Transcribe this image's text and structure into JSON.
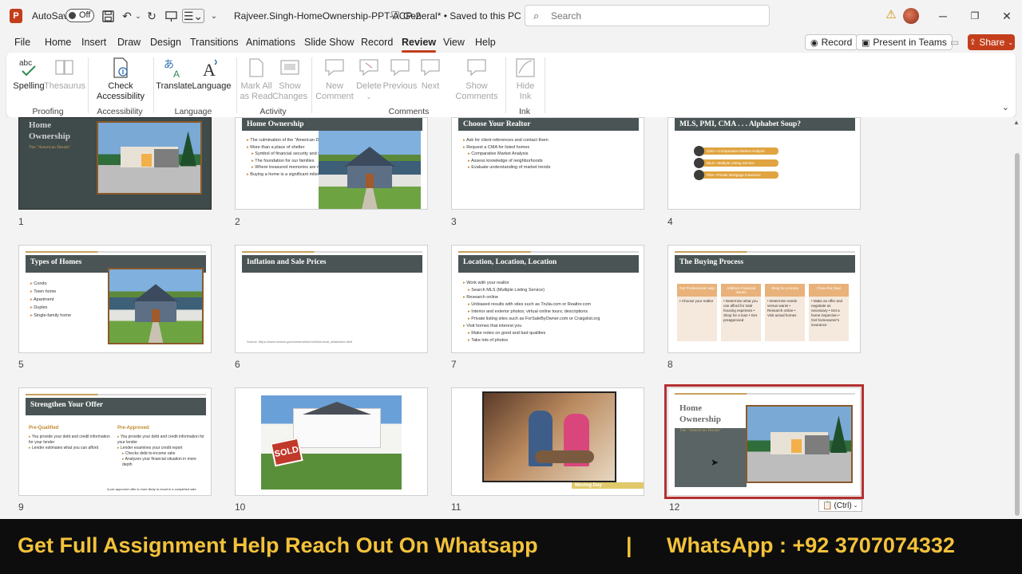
{
  "titlebar": {
    "app_logo": "P",
    "autosave_label": "AutoSave",
    "autosave_state": "Off",
    "document_title": "Rajveer.Singh-HomeOwnership-PPT-ACP-2",
    "sensitivity": "General* • Saved to this PC",
    "search_placeholder": "Search"
  },
  "menu": {
    "tabs": [
      "File",
      "Home",
      "Insert",
      "Draw",
      "Design",
      "Transitions",
      "Animations",
      "Slide Show",
      "Record",
      "Review",
      "View",
      "Help"
    ],
    "active_tab": "Review",
    "record_button": "Record",
    "present_teams_button": "Present in Teams",
    "share_button": "Share"
  },
  "ribbon": {
    "spelling": "Spelling",
    "thesaurus": "Thesaurus",
    "check_accessibility_1": "Check",
    "check_accessibility_2": "Accessibility",
    "translate": "Translate",
    "language": "Language",
    "mark_all_1": "Mark All",
    "mark_all_2": "as Read",
    "show_changes_1": "Show",
    "show_changes_2": "Changes",
    "new_comment_1": "New",
    "new_comment_2": "Comment",
    "delete": "Delete",
    "previous": "Previous",
    "next": "Next",
    "show_comments_1": "Show",
    "show_comments_2": "Comments",
    "hide_ink_1": "Hide",
    "hide_ink_2": "Ink",
    "groups": [
      "Proofing",
      "Accessibility",
      "Language",
      "Activity",
      "Comments",
      "Ink"
    ]
  },
  "slides": {
    "s1": {
      "num": "1",
      "title1": "Home",
      "title2": "Ownership",
      "sub": "The \"American Dream\""
    },
    "s2": {
      "num": "2",
      "title": "Home Ownership",
      "bullets": [
        "The culmination of the \"American Dream\"",
        "More than a place of shelter",
        "Symbol of financial security and stability",
        "The foundation for our families",
        "Where treasured memories are made",
        "Buying a home is a significant milestone"
      ]
    },
    "s3": {
      "num": "3",
      "title": "Choose Your Realtor",
      "bullets": [
        "Ask for client references and contact them",
        "Request a CMA for listed homes",
        "Comparative Market Analysis",
        "Assess knowledge of neighborhoods",
        "Evaluate understanding of market trends"
      ]
    },
    "s4": {
      "num": "4",
      "title": "MLS, PMI, CMA . . . Alphabet Soup?",
      "items": [
        "CMA—Comparative Market Analysis",
        "MLS—Multiple Listing Service",
        "PMI—Private Mortgage Insurance"
      ]
    },
    "s5": {
      "num": "5",
      "title": "Types of Homes",
      "bullets": [
        "Condo",
        "Town home",
        "Apartment",
        "Duplex",
        "Single-family home"
      ]
    },
    "s6": {
      "num": "6",
      "title": "Inflation and Sale Prices",
      "source": "Source: https://www.census.gov/construction/nrs/historical_data/index.html"
    },
    "s7": {
      "num": "7",
      "title": "Location, Location, Location",
      "bullets": [
        "Work with your realtor",
        "Search MLS (Multiple Listing Service)",
        "Research online",
        "Unbiased results with sites such as Trulia.com or Realtor.com",
        "Interior and exterior photos; virtual online tours; descriptions",
        "Private listing sites such as ForSaleByOwner.com or Craigslist.org",
        "Visit homes that interest you",
        "Make notes on good and bad qualities",
        "Take lots of photos"
      ]
    },
    "s8": {
      "num": "8",
      "title": "The Buying Process",
      "cols": [
        {
          "h": "Get Professional Help",
          "t": "• Choose your realtor"
        },
        {
          "h": "Address Financial Issues",
          "t": "• Determine what you can afford for total housing expenses • Shop for a loan • Get preapproved"
        },
        {
          "h": "Shop for a Home",
          "t": "• Determine needs versus wants • Research online • Visit actual homes"
        },
        {
          "h": "Close the Deal",
          "t": "• Make an offer and negotiate as necessary • Get a home inspection • Get homeowner's insurance"
        }
      ]
    },
    "s9": {
      "num": "9",
      "title": "Strengthen Your Offer",
      "col1_h": "Pre-Qualified",
      "col2_h": "Pre-Approved",
      "col1": [
        "You provide your debt and credit information for your lender",
        "Lender estimates what you can afford"
      ],
      "col2": [
        "You provide your debt and credit information for your lender",
        "Lender examines your credit report",
        "Checks debt-to-income ratio",
        "Analyzes your financial situation in more depth"
      ],
      "footer": "A pre-approved offer is more likely to result in a completed sale."
    },
    "s10": {
      "num": "10",
      "sign": "SOLD"
    },
    "s11": {
      "num": "11",
      "caption": "Moving Day"
    },
    "s12": {
      "num": "12",
      "title1": "Home",
      "title2": "Ownership",
      "sub": "The \"American Dream\""
    }
  },
  "paste_options": "(Ctrl)",
  "banner": {
    "left": "Get Full Assignment Help Reach Out On Whatsapp",
    "sep": "|",
    "right": "WhatsApp : +92 3707074332"
  }
}
